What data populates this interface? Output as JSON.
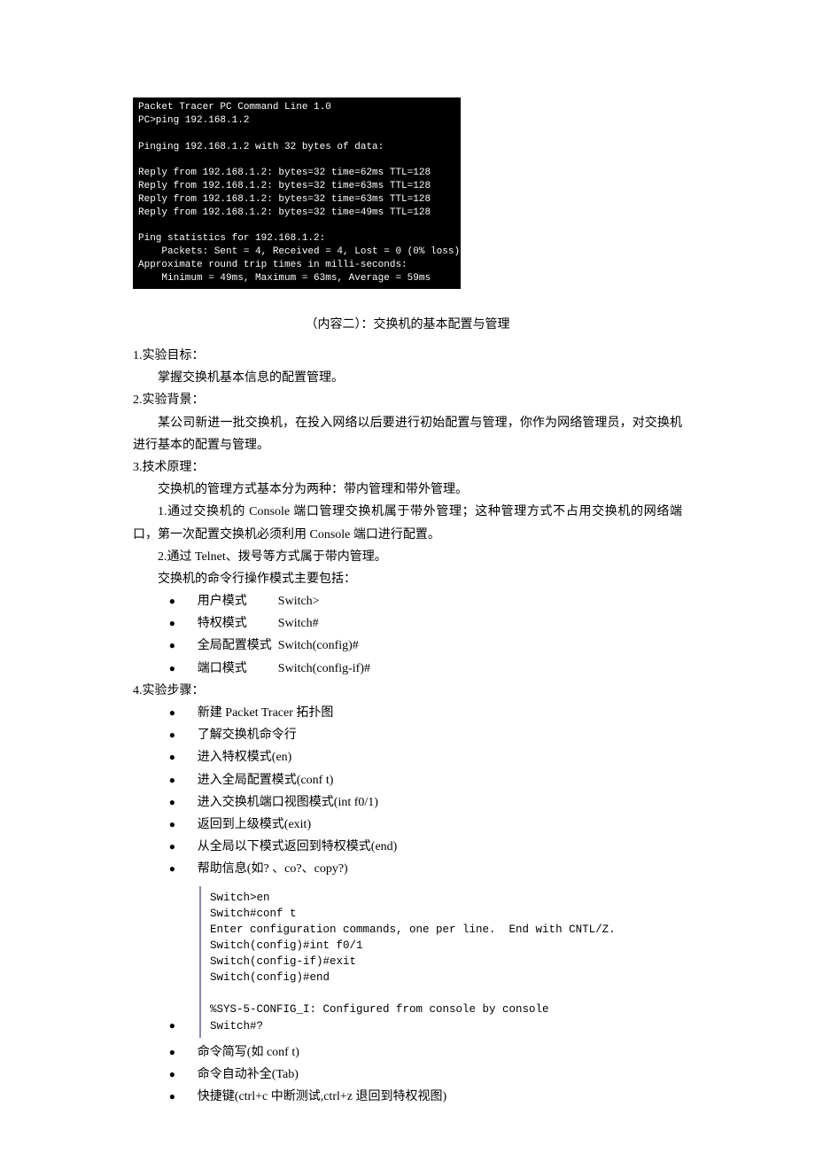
{
  "terminal": {
    "lines": "Packet Tracer PC Command Line 1.0\nPC>ping 192.168.1.2\n\nPinging 192.168.1.2 with 32 bytes of data:\n\nReply from 192.168.1.2: bytes=32 time=62ms TTL=128\nReply from 192.168.1.2: bytes=32 time=63ms TTL=128\nReply from 192.168.1.2: bytes=32 time=63ms TTL=128\nReply from 192.168.1.2: bytes=32 time=49ms TTL=128\n\nPing statistics for 192.168.1.2:\n    Packets: Sent = 4, Received = 4, Lost = 0 (0% loss),\nApproximate round trip times in milli-seconds:\n    Minimum = 49ms, Maximum = 63ms, Average = 59ms"
  },
  "section_title": "（内容二）：交换机的基本配置与管理",
  "s1": {
    "h": "1.实验目标：",
    "p1": "掌握交换机基本信息的配置管理。"
  },
  "s2": {
    "h": "2.实验背景：",
    "p1": "某公司新进一批交换机，在投入网络以后要进行初始配置与管理，你作为网络管理员，对交换机进行基本的配置与管理。"
  },
  "s3": {
    "h": "3.技术原理：",
    "p1": "交换机的管理方式基本分为两种：带内管理和带外管理。",
    "p2": "1.通过交换机的 Console 端口管理交换机属于带外管理；这种管理方式不占用交换机的网络端口，第一次配置交换机必须利用 Console 端口进行配置。",
    "p3": "2.通过 Telnet、拨号等方式属于带内管理。",
    "p4": "交换机的命令行操作模式主要包括：",
    "modes": [
      {
        "label": "用户模式",
        "cmd": "Switch>"
      },
      {
        "label": "特权模式",
        "cmd": "Switch#"
      },
      {
        "label": "全局配置模式",
        "cmd": "Switch(config)#"
      },
      {
        "label": "端口模式",
        "cmd": "Switch(config-if)#"
      }
    ]
  },
  "s4": {
    "h": "4.实验步骤：",
    "steps_a": [
      "新建 Packet Tracer  拓扑图",
      "了解交换机命令行",
      "进入特权模式(en)",
      "进入全局配置模式(conf t)",
      "进入交换机端口视图模式(int f0/1)",
      "返回到上级模式(exit)",
      "从全局以下模式返回到特权模式(end)",
      "帮助信息(如?  、co?、copy?)"
    ],
    "code": "Switch>en\nSwitch#conf t\nEnter configuration commands, one per line.  End with CNTL/Z.\nSwitch(config)#int f0/1\nSwitch(config-if)#exit\nSwitch(config)#end\n\n%SYS-5-CONFIG_I: Configured from console by console\nSwitch#?",
    "steps_b": [
      "命令简写(如   conf t)",
      "命令自动补全(Tab)",
      "快捷键(ctrl+c  中断测试,ctrl+z  退回到特权视图)"
    ]
  }
}
